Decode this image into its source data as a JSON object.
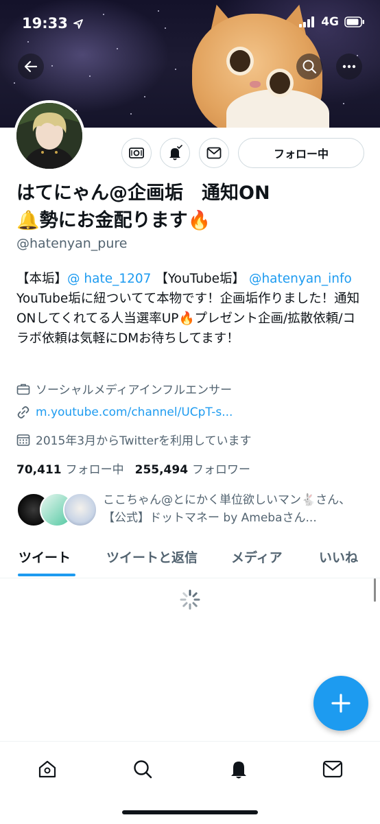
{
  "status_bar": {
    "time": "19:33",
    "network": "4G"
  },
  "profile": {
    "name_line1": "はてにゃん@企画垢　通知ON",
    "name_line2": "勢にお金配ります",
    "handle": "@hatenyan_pure",
    "follow_button_label": "フォロー中",
    "bio": {
      "prefix": "【本垢】",
      "mention1": "@ hate_1207",
      "mid": " 【YouTube垢】",
      "mention2": "@hatenyan_info",
      "rest1": " YouTube垢に紐ついてて本物です！企画垢作りました！通知ONしてくれてる人当選率UP",
      "rest2": "プレゼント企画/拡散依頼/コラボ依頼は気軽にDMお待ちしてます！"
    },
    "category": "ソーシャルメディアインフルエンサー",
    "website": "m.youtube.com/channel/UCpT-s...",
    "joined": "2015年3月からTwitterを利用しています",
    "following_count": "70,411",
    "following_label": "フォロー中",
    "followers_count": "255,494",
    "followers_label": "フォロワー",
    "followed_by_text": "ここちゃん@とにかく単位欲しいマン🐇さん、【公式】ドットマネー by Amebaさん..."
  },
  "tabs": [
    {
      "label": "ツイート",
      "active": true
    },
    {
      "label": "ツイートと返信",
      "active": false
    },
    {
      "label": "メディア",
      "active": false
    },
    {
      "label": "いいね",
      "active": false
    }
  ],
  "bottom_nav": [
    {
      "icon": "home-icon"
    },
    {
      "icon": "search-icon"
    },
    {
      "icon": "notifications-icon",
      "active": true
    },
    {
      "icon": "messages-icon"
    }
  ],
  "colors": {
    "accent": "#1d9bf0",
    "text": "#0f1419",
    "secondary": "#536471"
  }
}
